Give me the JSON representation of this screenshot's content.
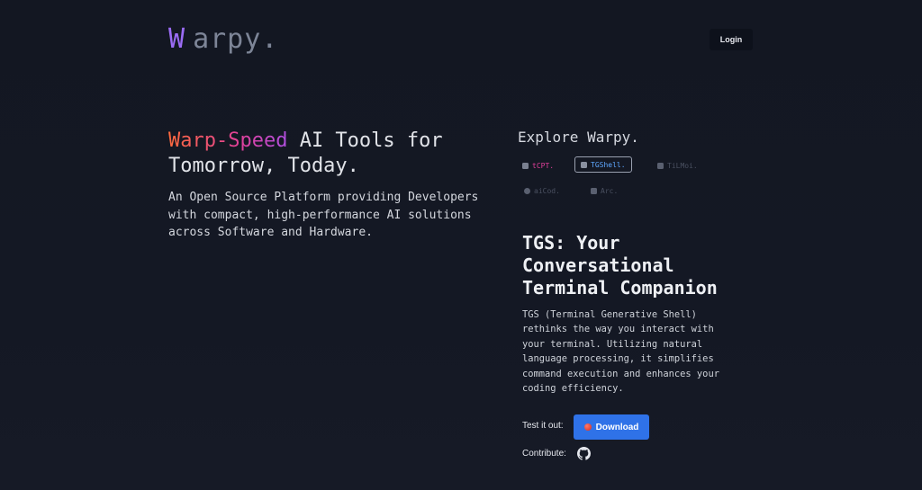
{
  "header": {
    "logo_initial": "W",
    "logo_rest": "arpy.",
    "login_label": "Login"
  },
  "hero": {
    "title_accent": "Warp-Speed",
    "title_rest": " AI Tools for Tomorrow, Today.",
    "description": "An Open Source Platform providing Developers with compact, high-performance AI solutions across Software and Hardware."
  },
  "explore": {
    "title": "Explore Warpy.",
    "tabs": [
      {
        "label": "tCPT.",
        "icon": "terminal-icon",
        "state": "normal"
      },
      {
        "label": "TGShell.",
        "icon": "terminal-icon",
        "state": "selected"
      },
      {
        "label": "TiLMoi.",
        "icon": "chip-icon",
        "state": "dim"
      },
      {
        "label": "aiCod.",
        "icon": "gear-icon",
        "state": "dim"
      },
      {
        "label": "Arc.",
        "icon": "document-icon",
        "state": "dim"
      }
    ]
  },
  "product": {
    "title": "TGS: Your Conversational Terminal Companion",
    "description": "TGS (Terminal Generative Shell) rethinks the way you interact with your terminal. Utilizing natural language processing, it simplifies command execution and enhances your coding efficiency.",
    "test_label": "Test it out:",
    "download_label": "Download",
    "contribute_label": "Contribute:"
  },
  "colors": {
    "background": "#131722",
    "logo_accent": "#9b6cf5",
    "download_button": "#2f72e8",
    "selected_tab_text": "#5fa8ff",
    "accent_pink": "#e0409a"
  }
}
